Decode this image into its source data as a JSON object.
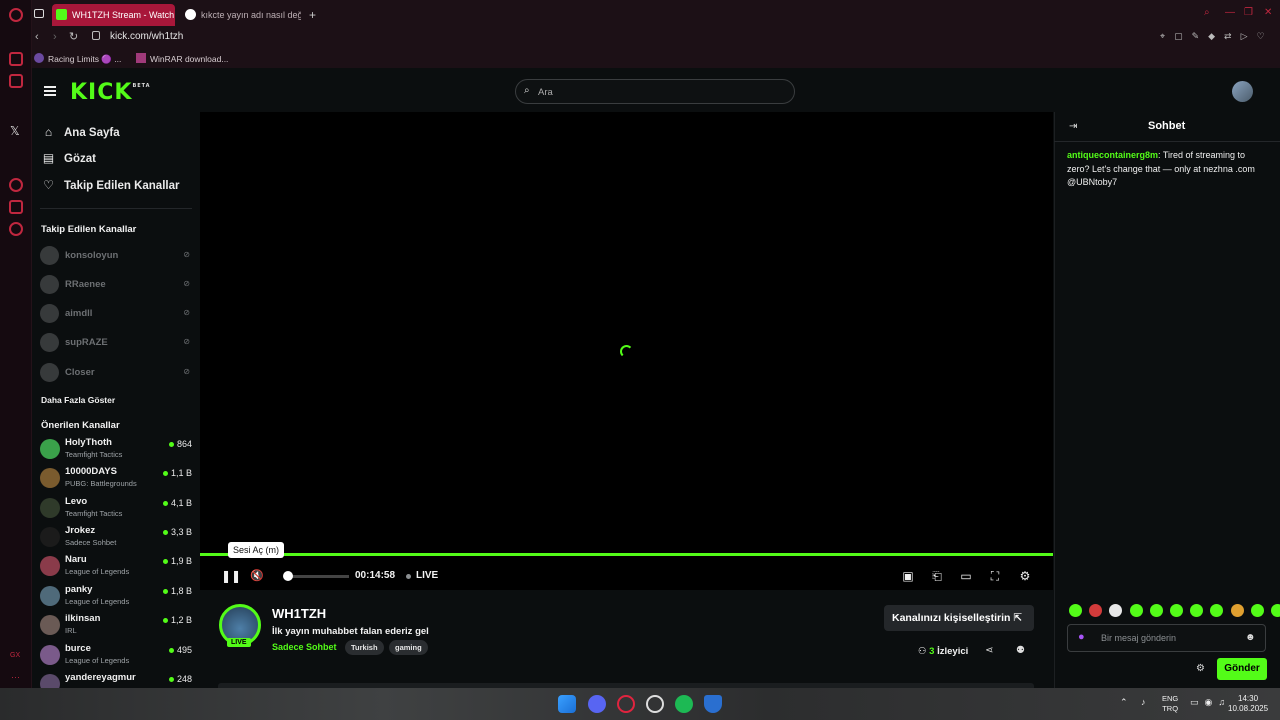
{
  "browser": {
    "tabs": [
      {
        "label": "WH1TZH Stream - Watch",
        "active": true
      },
      {
        "label": "kıkcte yayın adı nasıl değe",
        "active": false
      }
    ],
    "new_tab_icon": "plus-icon",
    "url": "kick.com/wh1tzh",
    "bookmarks": [
      {
        "label": "Racing Limits 🟣 ..."
      },
      {
        "label": "WinRAR download..."
      }
    ]
  },
  "header": {
    "logo": "KICK",
    "logo_badge": "BETA",
    "search_placeholder": "Ara"
  },
  "sidebar": {
    "nav": [
      {
        "label": "Ana Sayfa",
        "icon": "home-icon"
      },
      {
        "label": "Gözat",
        "icon": "browse-icon"
      },
      {
        "label": "Takip Edilen Kanallar",
        "icon": "heart-icon"
      }
    ],
    "followed_title": "Takip Edilen Kanallar",
    "followed": [
      {
        "name": "konsoloyun"
      },
      {
        "name": "RRaenee"
      },
      {
        "name": "aimdll"
      },
      {
        "name": "supRAZE"
      },
      {
        "name": "Closer"
      }
    ],
    "show_more": "Daha Fazla Göster",
    "recommended_title": "Önerilen Kanallar",
    "recommended": [
      {
        "name": "HolyThoth",
        "category": "Teamfight Tactics",
        "viewers": "864",
        "color": "#3aa14a"
      },
      {
        "name": "10000DAYS",
        "category": "PUBG: Battlegrounds",
        "viewers": "1,1 B",
        "color": "#7a5b2e"
      },
      {
        "name": "Levo",
        "category": "Teamfight Tactics",
        "viewers": "4,1 B",
        "color": "#2f3a2a"
      },
      {
        "name": "Jrokez",
        "category": "Sadece Sohbet",
        "viewers": "3,3 B",
        "color": "#1b1b1b"
      },
      {
        "name": "Naru",
        "category": "League of Legends",
        "viewers": "1,9 B",
        "color": "#8a3b4a"
      },
      {
        "name": "panky",
        "category": "League of Legends",
        "viewers": "1,8 B",
        "color": "#4f6a7a"
      },
      {
        "name": "ilkinsan",
        "category": "IRL",
        "viewers": "1,2 B",
        "color": "#6a5a55"
      },
      {
        "name": "burce",
        "category": "League of Legends",
        "viewers": "495",
        "color": "#7a5a8a"
      },
      {
        "name": "yandereyagmur",
        "category": "",
        "viewers": "248",
        "color": "#5a4a6a"
      }
    ]
  },
  "player": {
    "tooltip": "Sesi Aç (m)",
    "time": "00:14:58",
    "live_label": "LIVE",
    "progress_fraction": 1.0,
    "volume_fraction": 0.0
  },
  "channel": {
    "name": "WH1TZH",
    "live_badge": "LIVE",
    "title": "İlk yayın muhabbet falan ederiz gel",
    "category": "Sadece Sohbet",
    "tags": [
      "Turkish",
      "gaming"
    ],
    "customize_label": "Kanalınızı kişiselleştirin",
    "viewers_count": "3",
    "viewers_label": "İzleyici"
  },
  "chat": {
    "title": "Sohbet",
    "messages": [
      {
        "user": "antiquecontainerg8m",
        "text": "Tired of streaming to zero? Let's change that — only at nezhna .com @UBNtoby7"
      }
    ],
    "input_placeholder": "Bir mesaj gönderin",
    "send_label": "Gönder"
  },
  "taskbar": {
    "lang_top": "ENG",
    "lang_bottom": "TRQ",
    "time": "14:30",
    "date": "10.08.2025"
  },
  "colors": {
    "accent": "#53fc18",
    "opera_red": "#c0273f",
    "tab_active": "#a8173a",
    "background": "#0b0e0f"
  }
}
